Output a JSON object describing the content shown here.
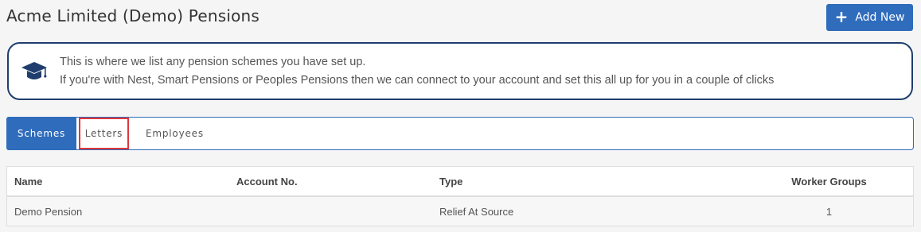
{
  "header": {
    "title": "Acme Limited (Demo) Pensions",
    "add_new_label": "Add New",
    "add_icon": "plus-icon"
  },
  "info": {
    "icon": "graduation-cap-icon",
    "line1": "This is where we list any pension schemes you have set up.",
    "line2": "If you're with Nest, Smart Pensions or Peoples Pensions then we can connect to your account and set this all up for you in a couple of clicks"
  },
  "tabs": [
    {
      "label": "Schemes",
      "active": true
    },
    {
      "label": "Letters",
      "active": false
    },
    {
      "label": "Employees",
      "active": false
    }
  ],
  "table": {
    "columns": [
      "Name",
      "Account No.",
      "Type",
      "Worker Groups"
    ],
    "rows": [
      {
        "name": "Demo Pension",
        "account_no": "",
        "type": "Relief At Source",
        "worker_groups": "1"
      }
    ]
  },
  "colors": {
    "accent": "#2f6cbc",
    "info_border": "#1f3e6e",
    "highlight": "#e0383e"
  }
}
